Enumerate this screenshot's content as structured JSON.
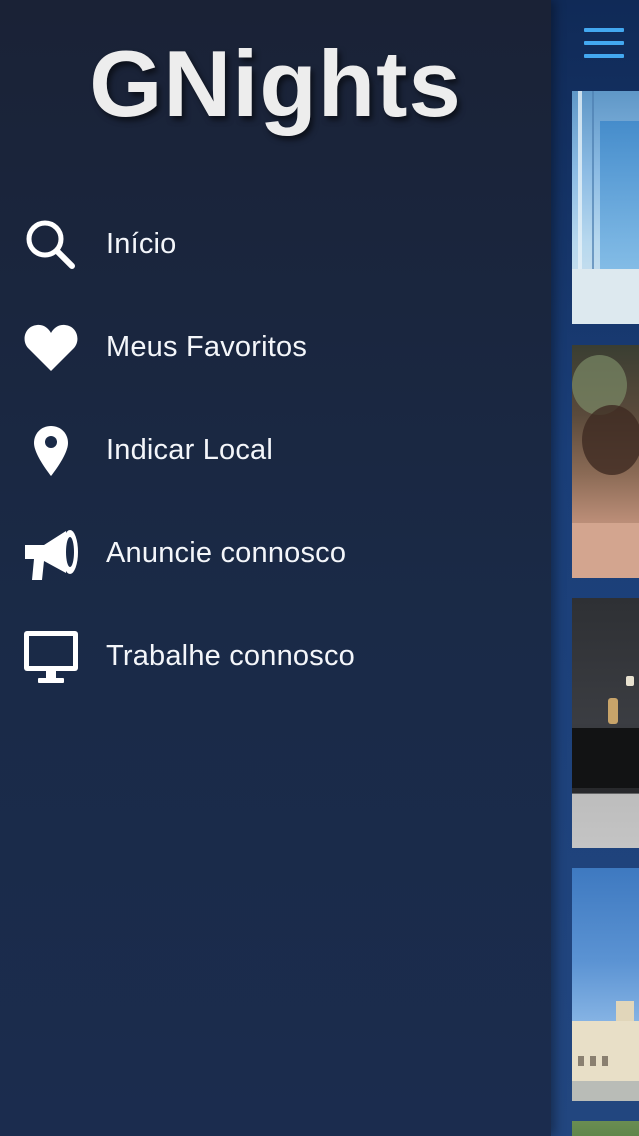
{
  "drawer": {
    "brand": "GNights",
    "items": [
      {
        "label": "Início",
        "icon": "search-icon"
      },
      {
        "label": "Meus Favoritos",
        "icon": "heart-icon"
      },
      {
        "label": "Indicar Local",
        "icon": "map-pin-icon"
      },
      {
        "label": "Anuncie connosco",
        "icon": "megaphone-icon"
      },
      {
        "label": "Trabalhe connosco",
        "icon": "monitor-icon"
      }
    ]
  },
  "main": {
    "menu_icon": "hamburger-menu-icon",
    "cards": [
      {
        "icon": "venue-photo-1"
      },
      {
        "icon": "venue-photo-2"
      },
      {
        "icon": "venue-photo-3"
      },
      {
        "icon": "venue-photo-4"
      },
      {
        "icon": "venue-photo-5"
      }
    ]
  },
  "colors": {
    "drawer_bg": "#1a2a47",
    "main_bg": "#1a3e78",
    "accent": "#43a8f0",
    "text": "#f4f6fa"
  }
}
